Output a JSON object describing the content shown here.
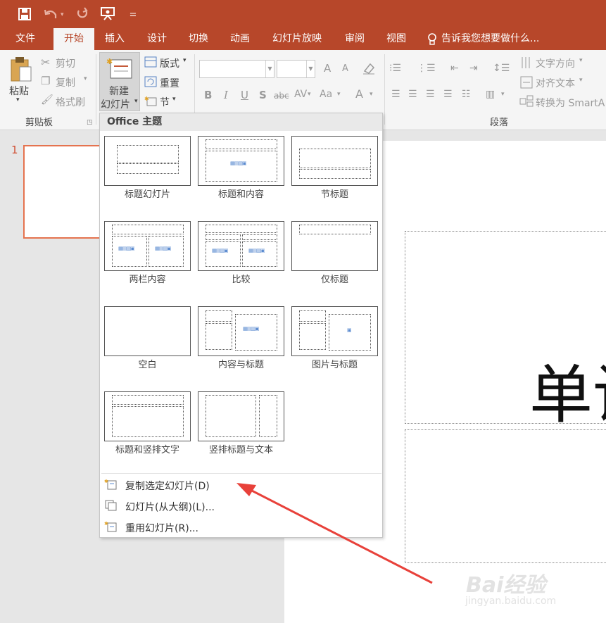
{
  "quick_access": {
    "save_icon": "save-icon",
    "undo_icon": "undo-icon",
    "redo_icon": "redo-icon",
    "present_icon": "present-icon",
    "customize_icon": "customize-icon"
  },
  "tabs": [
    {
      "label": "文件"
    },
    {
      "label": "开始"
    },
    {
      "label": "插入"
    },
    {
      "label": "设计"
    },
    {
      "label": "切换"
    },
    {
      "label": "动画"
    },
    {
      "label": "幻灯片放映"
    },
    {
      "label": "审阅"
    },
    {
      "label": "视图"
    }
  ],
  "tellme": "告诉我您想要做什么...",
  "clipboard": {
    "paste": "粘贴",
    "cut": "剪切",
    "copy": "复制",
    "format_painter": "格式刷",
    "group": "剪贴板"
  },
  "slides": {
    "new_line1": "新建",
    "new_line2": "幻灯片",
    "layout": "版式",
    "reset": "重置",
    "section": "节"
  },
  "font": {
    "bold": "B",
    "italic": "I",
    "underline": "U",
    "shadow": "S",
    "strike": "abc",
    "spacing": "AV",
    "case": "Aa",
    "color": "A",
    "grow": "A",
    "shrink": "A"
  },
  "paragraph": {
    "group": "段落",
    "text_direction": "文字方向",
    "align_text": "对齐文本",
    "smartart": "转换为 SmartA"
  },
  "thumbnail": {
    "number": "1"
  },
  "slide_text": "单设",
  "dropdown": {
    "header": "Office 主题",
    "layouts": [
      {
        "name": "标题幻灯片"
      },
      {
        "name": "标题和内容"
      },
      {
        "name": "节标题"
      },
      {
        "name": "两栏内容"
      },
      {
        "name": "比较"
      },
      {
        "name": "仅标题"
      },
      {
        "name": "空白"
      },
      {
        "name": "内容与标题"
      },
      {
        "name": "图片与标题"
      },
      {
        "name": "标题和竖排文字"
      },
      {
        "name": "竖排标题与文本"
      }
    ],
    "menu": [
      {
        "label": "复制选定幻灯片(D)"
      },
      {
        "label": "幻灯片(从大纲)(L)..."
      },
      {
        "label": "重用幻灯片(R)..."
      }
    ]
  },
  "watermark": {
    "logo": "Bai经验",
    "url": "jingyan.baidu.com"
  },
  "colors": {
    "accent": "#b7472a",
    "ribbon": "#f5f5f5",
    "annotation": "#e8413a"
  }
}
